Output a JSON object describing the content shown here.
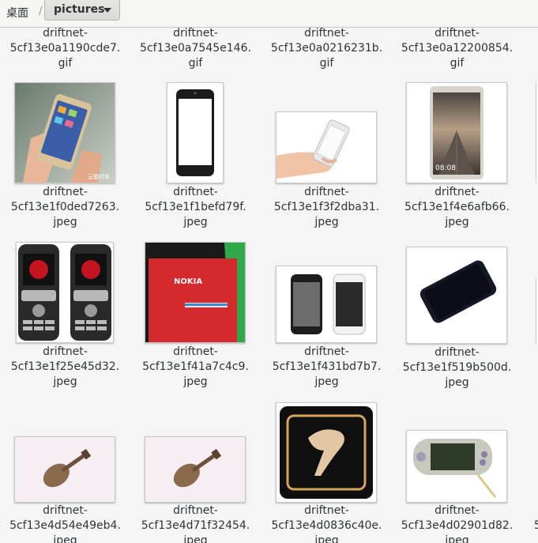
{
  "pathbar": {
    "home_label": "桌面",
    "separator": "/",
    "current_folder": "pictures",
    "dropdown_icon": "chevron-down-icon"
  },
  "files": [
    {
      "line1": "driftnet-",
      "line2": "5cf13e0a1190cde7.",
      "line3": "gif"
    },
    {
      "line1": "driftnet-",
      "line2": "5cf13e0a7545e146.",
      "line3": "gif"
    },
    {
      "line1": "driftnet-",
      "line2": "5cf13e0a0216231b.",
      "line3": "gif"
    },
    {
      "line1": "driftnet-",
      "line2": "5cf13e0a12200854.",
      "line3": "gif"
    },
    {
      "line1": "driftnet-",
      "line2": "5cf13e1f0ded7263.",
      "line3": "jpeg",
      "thumb": "hand-holding-gold-smartphone"
    },
    {
      "line1": "driftnet-",
      "line2": "5cf13e1f1befd79f.",
      "line3": "jpeg",
      "thumb": "white-screen-smartphone"
    },
    {
      "line1": "driftnet-",
      "line2": "5cf13e1f3f2dba31.",
      "line3": "jpeg",
      "thumb": "hand-holding-white-phone"
    },
    {
      "line1": "driftnet-",
      "line2": "5cf13e1f4e6afb66.",
      "line3": "jpeg",
      "thumb": "phone-with-pier-wallpaper"
    },
    {
      "line1": "driftnet-",
      "line2": "5cf13e1f25e45d32.",
      "line3": "jpeg",
      "thumb": "two-feature-phones"
    },
    {
      "line1": "driftnet-",
      "line2": "5cf13e1f41a7c4c9.",
      "line3": "jpeg",
      "thumb": "nokia-red-screen"
    },
    {
      "line1": "driftnet-",
      "line2": "5cf13e1f431bd7b7.",
      "line3": "jpeg",
      "thumb": "two-iphones"
    },
    {
      "line1": "driftnet-",
      "line2": "5cf13e1f519b500d.",
      "line3": "jpeg",
      "thumb": "black-smartphone-angled"
    },
    {
      "line1": "driftnet-",
      "line2": "5cf13e4d54e49eb4.",
      "line3": "jpeg",
      "thumb": "violin-pin"
    },
    {
      "line1": "driftnet-",
      "line2": "5cf13e4d71f32454.",
      "line3": "jpeg",
      "thumb": "violin-pin"
    },
    {
      "line1": "driftnet-",
      "line2": "5cf13e4d0836c40e.",
      "line3": "jpeg",
      "thumb": "belt-buckle-leopard"
    },
    {
      "line1": "driftnet-",
      "line2": "5cf13e4d02901d82.",
      "line3": "jpeg",
      "thumb": "handheld-game-console"
    }
  ],
  "thumb_text": {
    "watermark": "云繁时尚",
    "nokia_brand": "NOKIA",
    "clock": "08:08"
  },
  "partial_column": {
    "row4_label_fragment": "5"
  }
}
